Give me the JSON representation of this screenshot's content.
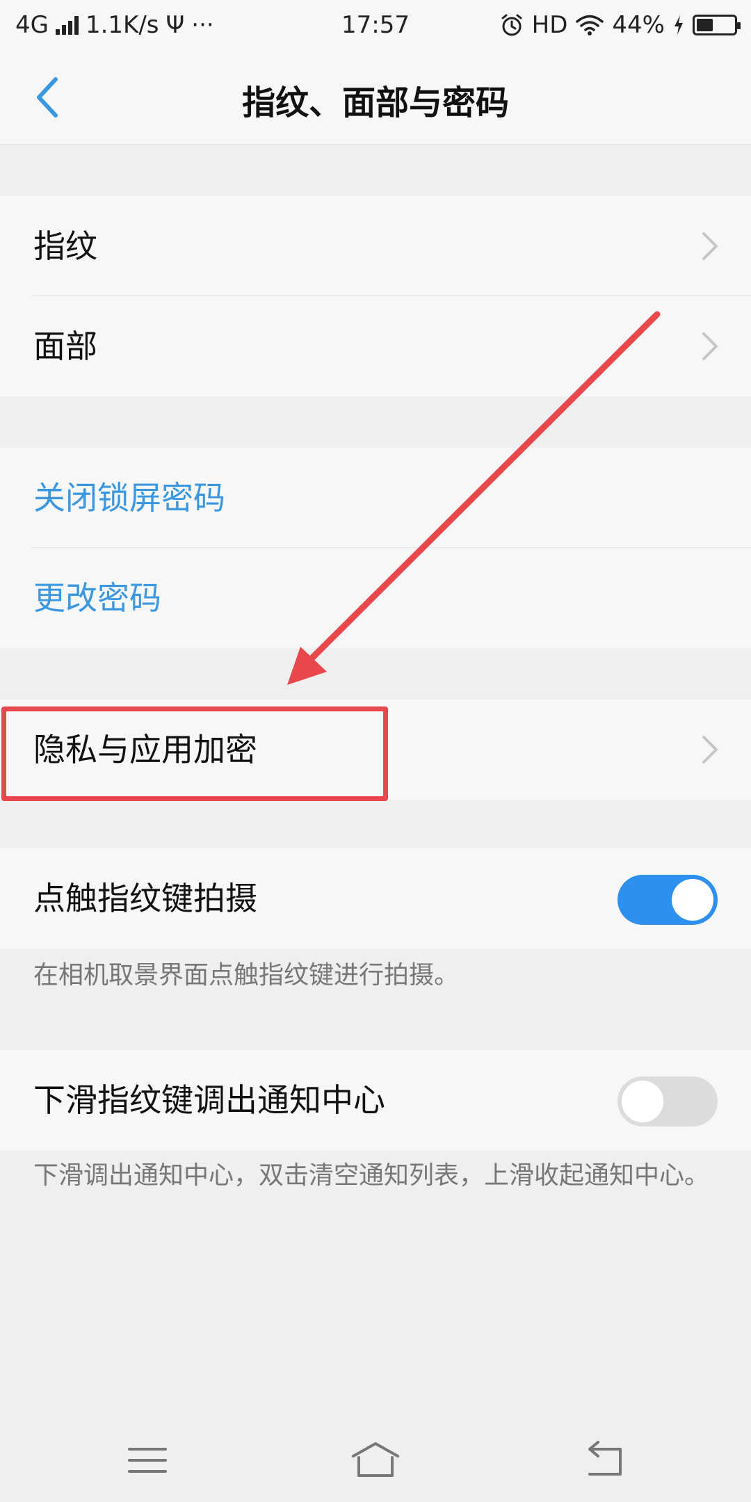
{
  "status_bar": {
    "network": "4G",
    "speed": "1.1K/s",
    "usb": "Ψ",
    "more": "···",
    "time": "17:57",
    "hd": "HD",
    "battery_percent": "44%",
    "battery_level": 0.44
  },
  "header": {
    "title": "指纹、面部与密码"
  },
  "biometrics": {
    "fingerprint": "指纹",
    "face": "面部"
  },
  "password": {
    "disable_lock": "关闭锁屏密码",
    "change": "更改密码"
  },
  "privacy": {
    "label": "隐私与应用加密"
  },
  "touch_capture": {
    "label": "点触指纹键拍摄",
    "enabled": true,
    "description": "在相机取景界面点触指纹键进行拍摄。"
  },
  "swipe_notify": {
    "label": "下滑指纹键调出通知中心",
    "enabled": false,
    "description": "下滑调出通知中心，双击清空通知列表，上滑收起通知中心。"
  },
  "colors": {
    "accent": "#3a97e0",
    "toggle_on": "#2d90ef",
    "annotation": "#e8474c"
  },
  "icons": {
    "back": "chevron-left-icon",
    "row_arrow": "chevron-right-icon",
    "nav_menu": "menu-icon",
    "nav_home": "home-icon",
    "nav_back": "back-icon"
  }
}
